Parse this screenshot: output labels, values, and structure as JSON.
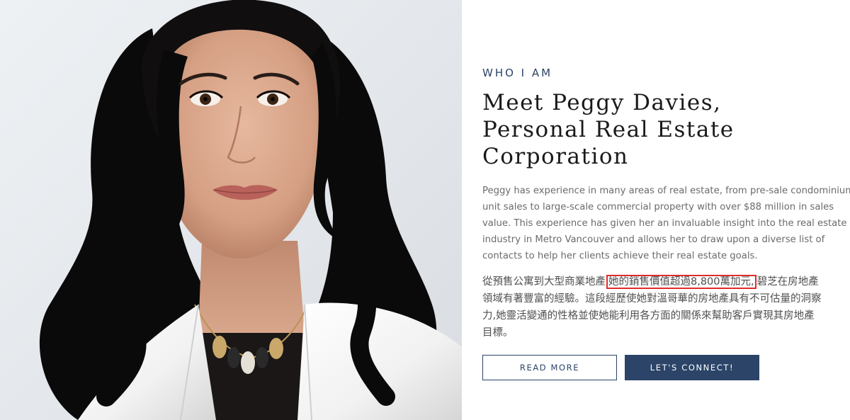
{
  "portrait": {
    "alt": "Portrait of Peggy Davies"
  },
  "about": {
    "eyebrow": "WHO I AM",
    "headline_lines": [
      "Meet Peggy Davies,",
      "Personal Real Estate",
      "Corporation"
    ],
    "bio_en_lines": [
      "Peggy has experience in many areas of real estate, from pre-sale condominium",
      "unit sales to large-scale commercial property with over $88 million in sales",
      "value. This experience has given her an invaluable insight into the real estate",
      "industry in Metro Vancouver and allows her to draw upon a diverse list of",
      "contacts to help her clients achieve their real estate goals."
    ],
    "bio_zh": {
      "line1_before": "從預售公寓到大型商業地產",
      "line1_highlight": "她的銷售價值超過8,800萬加元,",
      "line1_after": "碧芝在房地產",
      "line2": "領域有著豐富的經驗。這段經歷使她對溫哥華的房地產具有不可估量的洞察",
      "line3": "力,她靈活變通的性格並使她能利用各方面的關係來幫助客戶實現其房地產",
      "line4": "目標。"
    },
    "buttons": {
      "read_more": "READ MORE",
      "connect": "LET'S CONNECT!"
    }
  },
  "colors": {
    "brand_navy": "#2b4468",
    "highlight_red": "#e02b2b"
  }
}
